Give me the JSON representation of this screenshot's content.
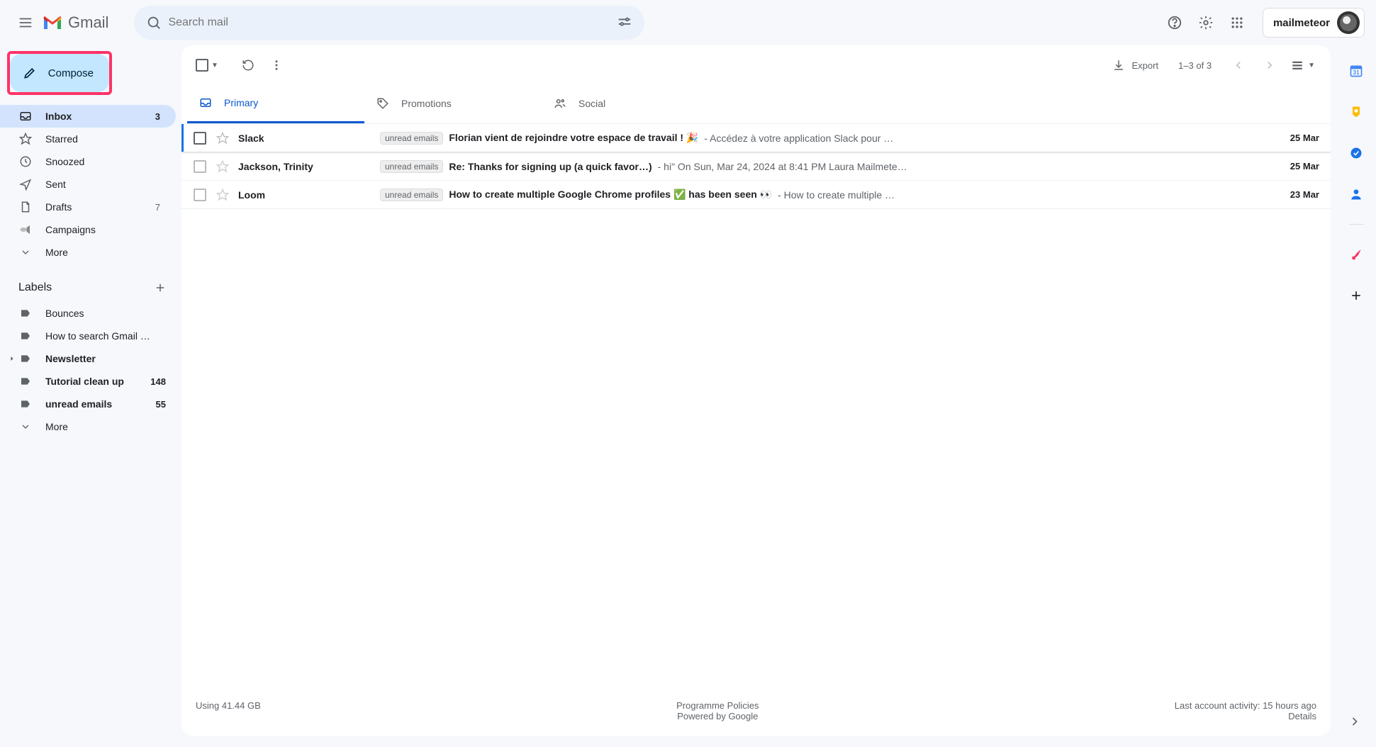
{
  "app_name": "Gmail",
  "search": {
    "placeholder": "Search mail"
  },
  "account": {
    "name": "mailmeteor"
  },
  "compose_label": "Compose",
  "nav": {
    "0": {
      "label": "Inbox",
      "count": "3"
    },
    "1": {
      "label": "Starred"
    },
    "2": {
      "label": "Snoozed"
    },
    "3": {
      "label": "Sent"
    },
    "4": {
      "label": "Drafts",
      "count": "7"
    },
    "5": {
      "label": "Campaigns"
    },
    "6": {
      "label": "More"
    }
  },
  "labels_header": "Labels",
  "labels": {
    "0": {
      "name": "Bounces"
    },
    "1": {
      "name": "How to search Gmail by …"
    },
    "2": {
      "name": "Newsletter"
    },
    "3": {
      "name": "Tutorial clean up",
      "count": "148"
    },
    "4": {
      "name": "unread emails",
      "count": "55"
    },
    "5": {
      "name": "More"
    }
  },
  "toolbar": {
    "export": "Export",
    "pager": "1–3 of 3"
  },
  "tabs": {
    "0": {
      "label": "Primary"
    },
    "1": {
      "label": "Promotions"
    },
    "2": {
      "label": "Social"
    }
  },
  "mails": {
    "0": {
      "sender": "Slack",
      "tag": "unread emails",
      "subject": "Florian vient de rejoindre votre espace de travail ! 🎉",
      "snippet": " - Accédez à votre application Slack pour …",
      "date": "25 Mar"
    },
    "1": {
      "sender": "Jackson, Trinity",
      "tag": "unread emails",
      "subject": "Re: Thanks for signing up (a quick favor…)",
      "snippet": " - hi\" On Sun, Mar 24, 2024 at 8:41 PM Laura Mailmete…",
      "date": "25 Mar"
    },
    "2": {
      "sender": "Loom",
      "tag": "unread emails",
      "subject": "How to create multiple Google Chrome profiles ✅ has been seen 👀",
      "snippet": " - How to create multiple …",
      "date": "23 Mar"
    }
  },
  "footer": {
    "storage": "Using 41.44 GB",
    "policies": "Programme Policies",
    "powered": "Powered by Google",
    "activity": "Last account activity: 15 hours ago",
    "details": "Details"
  }
}
